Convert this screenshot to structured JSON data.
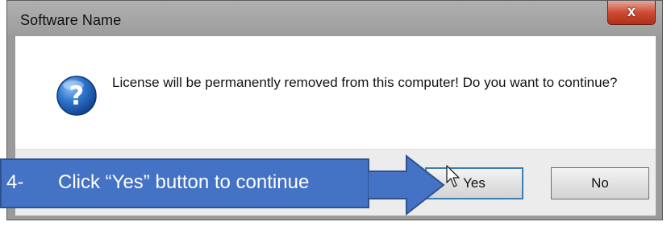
{
  "dialog": {
    "title": "Software Name",
    "close_label": "x",
    "message": "License will be permanently removed from this computer! Do you want to continue?",
    "icon": "question-icon",
    "buttons": {
      "yes": "Yes",
      "no": "No"
    }
  },
  "annotation": {
    "step": "4-",
    "text": "Click “Yes” button to continue",
    "color": "#4472c4"
  }
}
